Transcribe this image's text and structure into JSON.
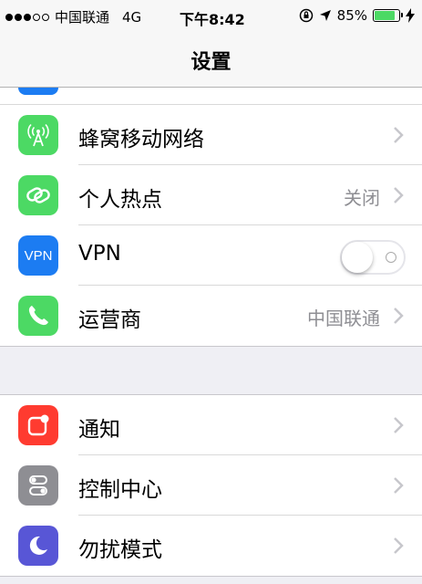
{
  "status_bar": {
    "carrier": "中国联通",
    "network": "4G",
    "time": "下午8:42",
    "battery_percent": "85%",
    "battery_level": 0.85,
    "signal_bars": 3,
    "icons": [
      "orientation-lock-icon",
      "location-arrow-icon",
      "battery-icon",
      "charging-bolt-icon"
    ]
  },
  "nav": {
    "title": "设置"
  },
  "group1": [
    {
      "label": "蜂窝移动网络",
      "icon": "antenna-icon",
      "icon_color": "#4cd964"
    },
    {
      "label": "个人热点",
      "value": "关闭",
      "icon": "hotspot-link-icon",
      "icon_color": "#4cd964"
    },
    {
      "label": "VPN",
      "icon_text": "VPN",
      "icon": "vpn-icon",
      "icon_color": "#1c7cf2",
      "toggle_on": false
    },
    {
      "label": "运营商",
      "value": "中国联通",
      "icon": "phone-icon",
      "icon_color": "#4cd964"
    }
  ],
  "group2": [
    {
      "label": "通知",
      "icon": "notifications-icon",
      "icon_color": "#ff3b30"
    },
    {
      "label": "控制中心",
      "icon": "control-center-icon",
      "icon_color": "#8e8e93"
    },
    {
      "label": "勿扰模式",
      "icon": "moon-icon",
      "icon_color": "#5856d6"
    }
  ]
}
